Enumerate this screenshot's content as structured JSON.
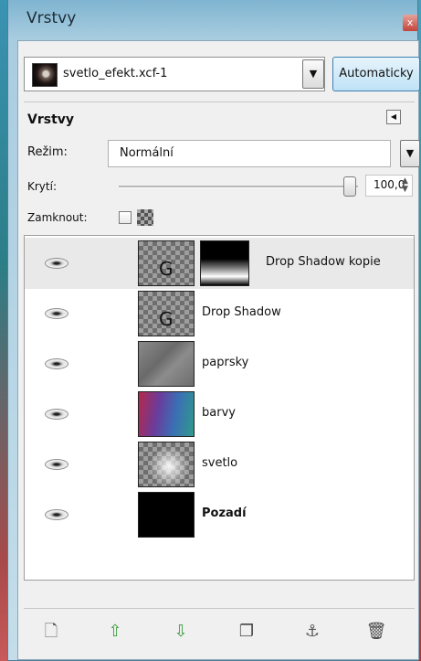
{
  "window": {
    "title": "Vrstvy",
    "close_glyph": "x"
  },
  "image_selector": {
    "name": "svetlo_efekt.xcf-1",
    "auto_button": "Automaticky",
    "dropdown_icon": "triangle-down-icon"
  },
  "panel": {
    "title": "Vrstvy",
    "mode_label": "Režim:",
    "mode_value": "Normální",
    "opacity_label": "Krytí:",
    "opacity_value": "100,0",
    "lock_label": "Zamknout:",
    "opacity_level": 1.0
  },
  "layers": [
    {
      "name": "Drop Shadow kopie",
      "thumb": "checker",
      "has_mask": true,
      "glyph": "G",
      "selected": true,
      "visible": true
    },
    {
      "name": "Drop Shadow",
      "thumb": "checker",
      "has_mask": false,
      "glyph": "G",
      "selected": false,
      "visible": true
    },
    {
      "name": "paprsky",
      "thumb": "paprsky",
      "has_mask": false,
      "glyph": "",
      "selected": false,
      "visible": true
    },
    {
      "name": "barvy",
      "thumb": "barvy",
      "has_mask": false,
      "glyph": "",
      "selected": false,
      "visible": true
    },
    {
      "name": "svetlo",
      "thumb": "svetlo",
      "has_mask": false,
      "glyph": "",
      "selected": false,
      "visible": true
    },
    {
      "name": "Pozadí",
      "thumb": "pozadi",
      "has_mask": false,
      "glyph": "",
      "selected": false,
      "visible": true,
      "bold": true
    }
  ],
  "toolbar": [
    {
      "name": "new-layer-button",
      "icon": "new-document-icon",
      "glyph": "🗋",
      "color": "#5c5c5c"
    },
    {
      "name": "raise-layer-button",
      "icon": "arrow-up-icon",
      "glyph": "⇧",
      "color": "#3a9a3a"
    },
    {
      "name": "lower-layer-button",
      "icon": "arrow-down-icon",
      "glyph": "⇩",
      "color": "#3a9a3a"
    },
    {
      "name": "duplicate-layer-button",
      "icon": "duplicate-icon",
      "glyph": "❐",
      "color": "#454545"
    },
    {
      "name": "anchor-layer-button",
      "icon": "anchor-icon",
      "glyph": "⚓",
      "color": "#5a5a5a"
    },
    {
      "name": "delete-layer-button",
      "icon": "trash-icon",
      "glyph": "🗑",
      "color": "#454545"
    }
  ]
}
